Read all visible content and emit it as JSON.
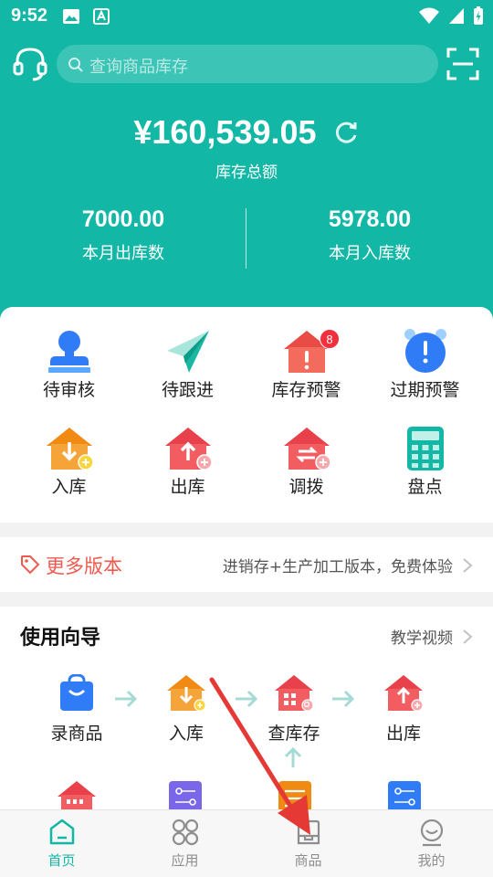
{
  "status_bar": {
    "time": "9:52"
  },
  "search": {
    "placeholder": "查询商品库存"
  },
  "summary": {
    "total_amount": "¥160,539.05",
    "total_label": "库存总额",
    "out_value": "7000.00",
    "out_label": "本月出库数",
    "in_value": "5978.00",
    "in_label": "本月入库数"
  },
  "quick_actions": [
    {
      "label": "待审核",
      "icon": "reviewer-icon"
    },
    {
      "label": "待跟进",
      "icon": "paper-plane-icon"
    },
    {
      "label": "库存预警",
      "icon": "stock-warning-icon",
      "badge": "8"
    },
    {
      "label": "过期预警",
      "icon": "alarm-clock-icon"
    },
    {
      "label": "入库",
      "icon": "stock-in-icon"
    },
    {
      "label": "出库",
      "icon": "stock-out-icon"
    },
    {
      "label": "调拨",
      "icon": "transfer-icon"
    },
    {
      "label": "盘点",
      "icon": "calculator-icon"
    }
  ],
  "banner": {
    "title": "更多版本",
    "description": "进销存+生产加工版本，免费体验"
  },
  "guide": {
    "title": "使用向导",
    "video_label": "教学视频",
    "steps": [
      {
        "label": "录商品"
      },
      {
        "label": "入库"
      },
      {
        "label": "查库存"
      },
      {
        "label": "出库"
      }
    ]
  },
  "bottom_nav": [
    {
      "label": "首页",
      "active": true
    },
    {
      "label": "应用",
      "active": false
    },
    {
      "label": "商品",
      "active": false
    },
    {
      "label": "我的",
      "active": false
    }
  ],
  "colors": {
    "brand": "#12b7a6",
    "orange": "#f39320",
    "red": "#f0545a",
    "blue": "#2f7cf6",
    "accent_text": "#ef5a4f",
    "annotation": "#e53935"
  }
}
